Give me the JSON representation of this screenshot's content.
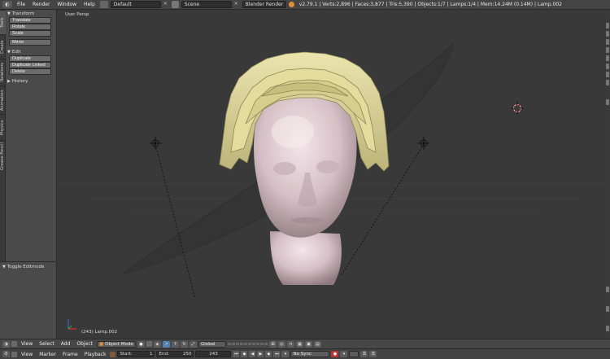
{
  "header": {
    "menus": [
      "File",
      "Render",
      "Window",
      "Help"
    ],
    "layout": "Default",
    "scene": "Scene",
    "engine": "Blender Render",
    "stats": "v2.79.1 | Verts:2,896 | Faces:3,877 | Tris:5,390 | Objects:1/7 | Lamps:1/4 | Mem:14.24M (0.14M) | Lamp.002"
  },
  "tabs": [
    "Tools",
    "Create",
    "Relations",
    "Animation",
    "Physics",
    "Grease Pencil"
  ],
  "toolshelf": {
    "transform": {
      "title": "Transform",
      "buttons": [
        "Translate",
        "Rotate",
        "Scale"
      ],
      "mirror": "Mirror"
    },
    "edit": {
      "title": "Edit",
      "buttons": [
        "Duplicate",
        "Duplicate Linked",
        "Delete"
      ]
    },
    "history": "History"
  },
  "last_operator": "Toggle Editmode",
  "viewport": {
    "view_label": "User Persp",
    "object_label": "(243) Lamp.002"
  },
  "bottom3d": {
    "menus": [
      "View",
      "Select",
      "Add",
      "Object"
    ],
    "mode": "Object Mode",
    "orientation": "Global"
  },
  "timeline": {
    "menus": [
      "View",
      "Marker",
      "Frame",
      "Playback"
    ],
    "start_label": "Start:",
    "start_value": "1",
    "end_label": "End:",
    "end_value": "250",
    "current": "243",
    "sync": "No Sync"
  },
  "colors": {
    "viewport_bg": "#393939",
    "hair": "#e3dc9c",
    "head": "#d9c4ca",
    "accent": "#e08f3a"
  }
}
